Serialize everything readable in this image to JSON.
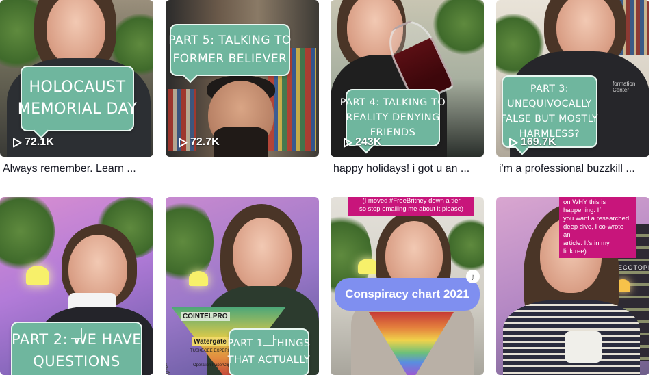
{
  "videos": [
    {
      "overlay": [
        "HOLOCAUST",
        "MEMORIAL DAY"
      ],
      "views": "72.1K",
      "caption": "Always remember. Learn ..."
    },
    {
      "overlay": [
        "PART 5: TALKING TO",
        "FORMER BELIEVER"
      ],
      "views": "72.7K",
      "caption": ""
    },
    {
      "overlay": [
        "PART 4: TALKING TO",
        "REALITY DENYING",
        "FRIENDS"
      ],
      "views": "243K",
      "caption": "happy holidays! i got u an ..."
    },
    {
      "overlay": [
        "PART 3:",
        "UNEQUIVOCALLY",
        "FALSE BUT MOSTLY",
        "HARMLESS?"
      ],
      "views": "169.7K",
      "caption": "i'm a professional buzzkill ...",
      "shirt_text": "formation Center"
    },
    {
      "overlay": [
        "PART 2: WE HAVE",
        "QUESTIONS"
      ]
    },
    {
      "overlay": [
        "PART 1: THINGS",
        "THAT ACTUALLY"
      ],
      "chart_words": [
        "COINTELPRO",
        "Watergate",
        "TUSKEGEE EXPERIMENT",
        "Operation PaperClip",
        "credit @to"
      ]
    },
    {
      "banner": [
        "(I moved #FreeBritney down a tier",
        "so stop emailing me about it please)"
      ],
      "pill": "Conspiracy chart 2021"
    },
    {
      "banner": [
        "on WHY this is happening. If",
        "you want a researched",
        "deep dive, I co-wrote an",
        "article. It's in my linktree)"
      ],
      "shelf_text": "ECOTOPI"
    }
  ],
  "colors": {
    "bubble": "#6fb69e",
    "pill": "#7f8ff0",
    "banner": "#c8157b",
    "caption": "#161823"
  },
  "icons": {
    "views": "play-icon",
    "platform": "tiktok-icon"
  }
}
